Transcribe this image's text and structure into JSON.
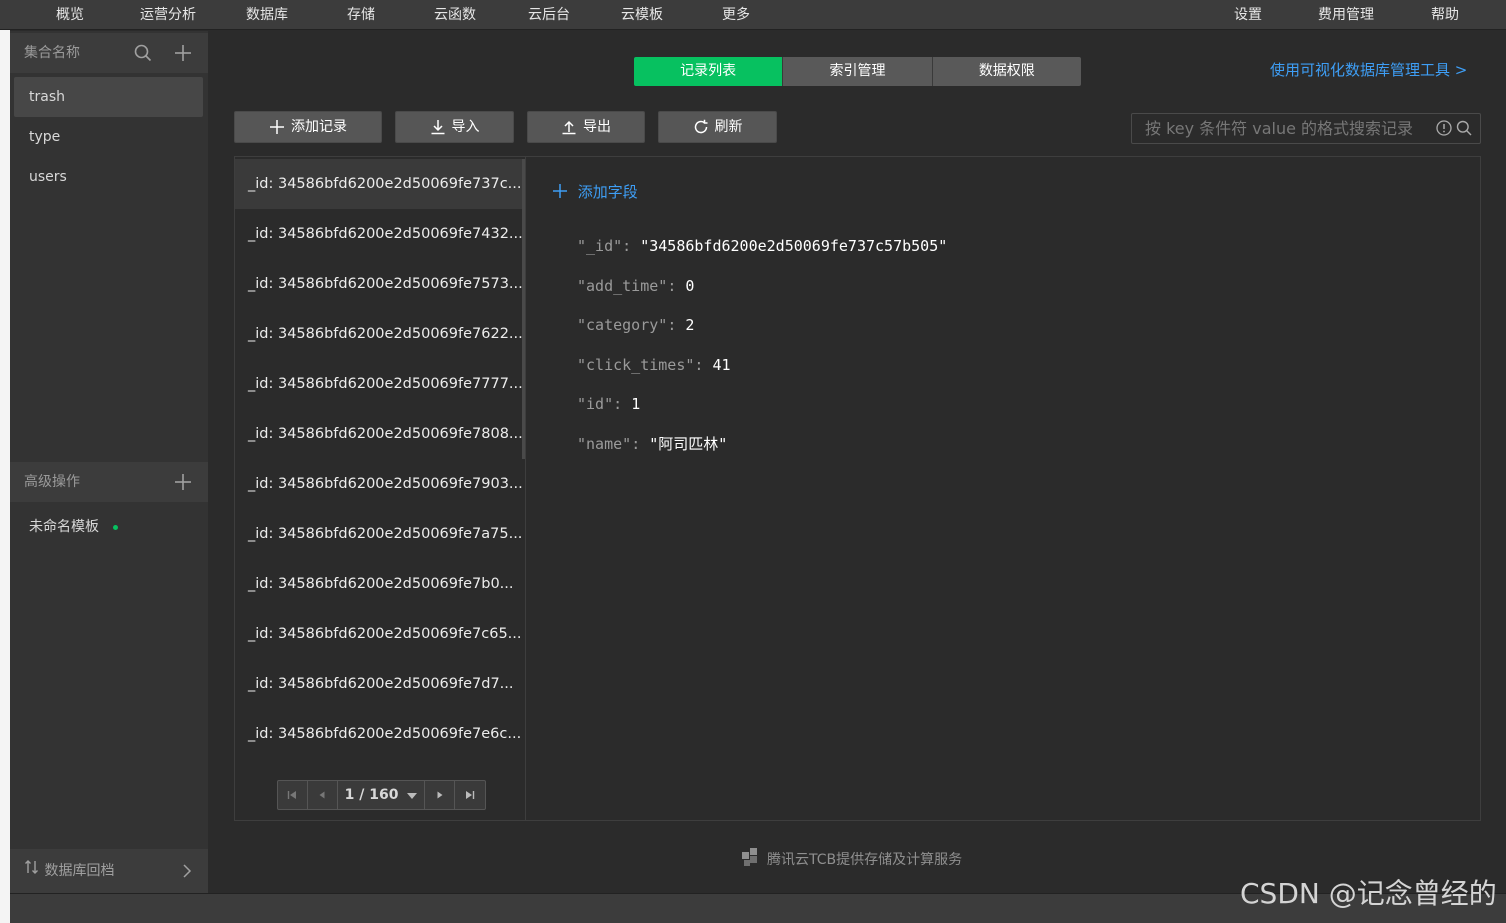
{
  "nav": {
    "left": [
      "概览",
      "运营分析",
      "数据库",
      "存储",
      "云函数",
      "云后台",
      "云模板",
      "更多"
    ],
    "right": [
      "设置",
      "费用管理",
      "帮助"
    ]
  },
  "sidebar": {
    "collections_header": "集合名称",
    "collections": [
      "trash",
      "type",
      "users"
    ],
    "advanced_header": "高级操作",
    "template_item": "未命名模板",
    "backup_label": "数据库回档"
  },
  "tabs": [
    "记录列表",
    "索引管理",
    "数据权限"
  ],
  "visual_tool_link": "使用可视化数据库管理工具 >",
  "toolbar": {
    "add": "添加记录",
    "import": "导入",
    "export": "导出",
    "refresh": "刷新"
  },
  "search": {
    "placeholder": "按 key 条件符 value 的格式搜索记录"
  },
  "records": [
    "_id: 34586bfd6200e2d50069fe737c...",
    "_id: 34586bfd6200e2d50069fe7432...",
    "_id: 34586bfd6200e2d50069fe7573...",
    "_id: 34586bfd6200e2d50069fe7622...",
    "_id: 34586bfd6200e2d50069fe7777...",
    "_id: 34586bfd6200e2d50069fe7808...",
    "_id: 34586bfd6200e2d50069fe7903...",
    "_id: 34586bfd6200e2d50069fe7a75...",
    "_id: 34586bfd6200e2d50069fe7b0...",
    "_id: 34586bfd6200e2d50069fe7c65...",
    "_id: 34586bfd6200e2d50069fe7d7...",
    "_id: 34586bfd6200e2d50069fe7e6c..."
  ],
  "pager": {
    "page_text": "1 / 160"
  },
  "detail": {
    "add_field": "添加字段",
    "fields": [
      {
        "key": "\"_id\"",
        "value": "\"34586bfd6200e2d50069fe737c57b505\""
      },
      {
        "key": "\"add_time\"",
        "value": "0"
      },
      {
        "key": "\"category\"",
        "value": "2"
      },
      {
        "key": "\"click_times\"",
        "value": "41"
      },
      {
        "key": "\"id\"",
        "value": "1"
      },
      {
        "key": "\"name\"",
        "value": "\"阿司匹林\""
      }
    ]
  },
  "footer_note": "腾讯云TCB提供存储及计算服务",
  "watermark": "CSDN @记念曾经的",
  "colors": {
    "accent_green": "#07c160",
    "link_blue": "#3e9ef5",
    "template_dot": "#07c160"
  }
}
